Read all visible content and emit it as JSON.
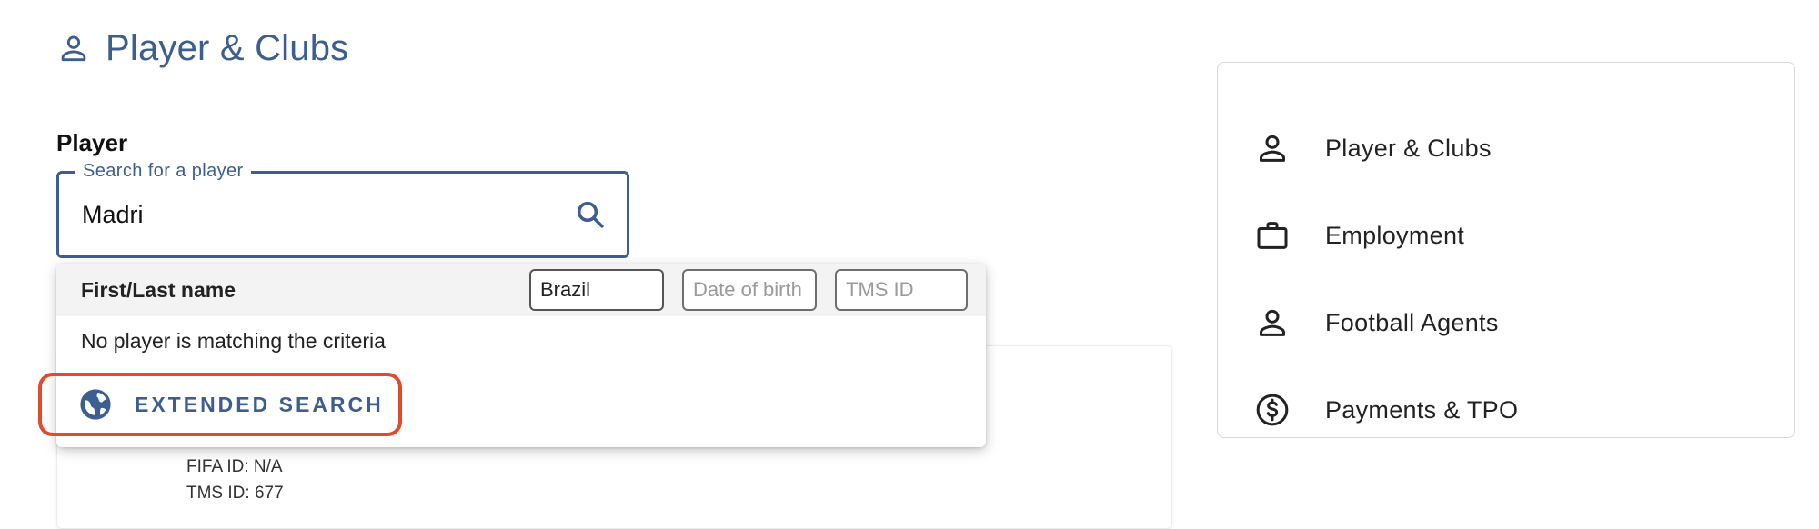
{
  "header": {
    "title": "Player & Clubs",
    "icon": "person-outline-icon"
  },
  "player_section": {
    "label": "Player",
    "search": {
      "legend": "Search for a player",
      "value": "Madri",
      "icon": "search-icon"
    }
  },
  "dropdown": {
    "column_label": "First/Last name",
    "filters": {
      "nationality_value": "Brazil",
      "dob_placeholder": "Date of birth",
      "tms_placeholder": "TMS ID"
    },
    "empty_message": "No player is matching the criteria",
    "extended_search": {
      "label": "EXTENDED SEARCH",
      "icon": "globe-icon",
      "highlight_color": "#e24a2e"
    }
  },
  "background_card": {
    "fifa_id": "FIFA ID: N/A",
    "tms_id": "TMS ID: 677"
  },
  "nav": {
    "items": [
      {
        "label": "Player & Clubs",
        "icon": "person-outline-icon"
      },
      {
        "label": "Employment",
        "icon": "briefcase-icon"
      },
      {
        "label": "Football Agents",
        "icon": "person-outline-icon"
      },
      {
        "label": "Payments & TPO",
        "icon": "dollar-circle-icon"
      }
    ]
  },
  "colors": {
    "accent": "#3d5f8f",
    "text": "#212121",
    "highlight": "#e24a2e"
  }
}
